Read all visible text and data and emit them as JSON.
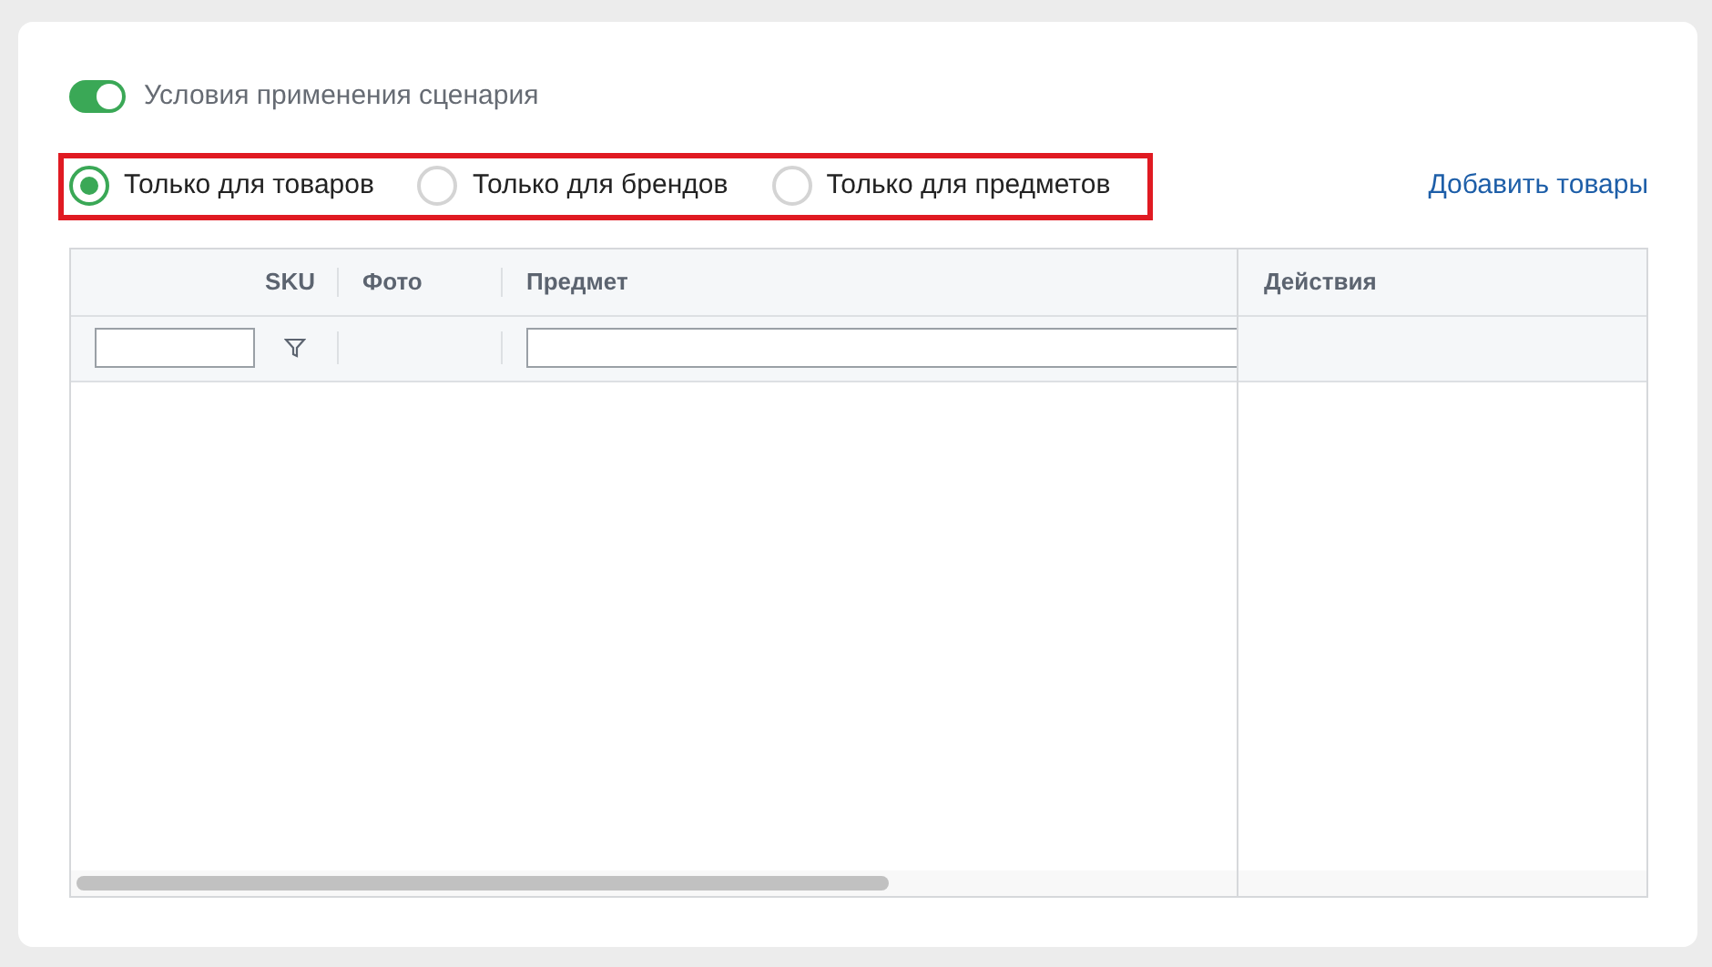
{
  "toggle": {
    "label": "Условия применения сценария",
    "on": true
  },
  "radios": [
    {
      "label": "Только для товаров",
      "selected": true
    },
    {
      "label": "Только для брендов",
      "selected": false
    },
    {
      "label": "Только для предметов",
      "selected": false
    }
  ],
  "add_link": "Добавить товары",
  "table": {
    "columns": [
      "SKU",
      "Фото",
      "Предмет",
      "Действия"
    ]
  }
}
